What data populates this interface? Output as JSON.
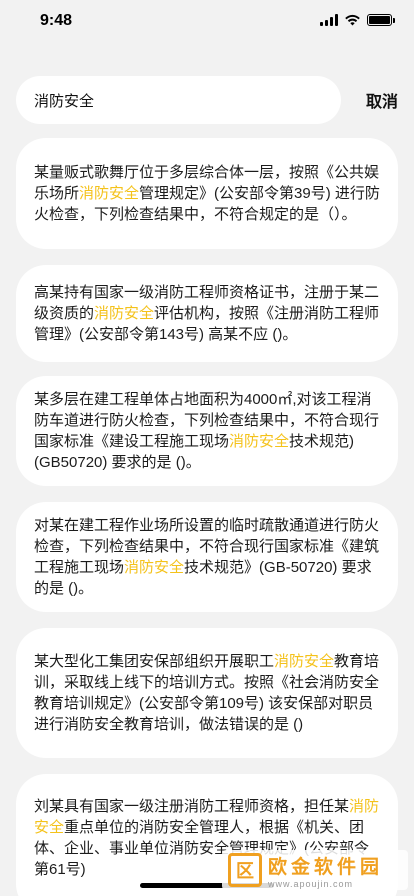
{
  "status_bar": {
    "time": "9:48"
  },
  "search": {
    "value": "消防安全",
    "cancel_label": "取消"
  },
  "highlight_color": "#f4c21b",
  "results": [
    {
      "segments": [
        "某量贩式歌舞厅位于多层综合体一层，按照《公共娱乐场所",
        "消防安全",
        "管理规定》(公安部令第39号) 进行防火检查，下列检查结果中，不符合规定的是（）。"
      ]
    },
    {
      "segments": [
        "高某持有国家一级消防工程师资格证书，注册于某二级资质的",
        "消防安全",
        "评估机构，按照《注册消防工程师管理》(公安部令第143号) 高某不应 ()。"
      ]
    },
    {
      "segments": [
        "某多层在建工程单体占地面积为4000㎡,对该工程消防车道进行防火检查，下列检查结果中，不符合现行国家标准《建设工程施工现场",
        "消防安全",
        "技术规范)(GB50720) 要求的是 ()。"
      ]
    },
    {
      "segments": [
        "对某在建工程作业场所设置的临时疏散通道进行防火检查，下列检查结果中，不符合现行国家标准《建筑工程施工现场",
        "消防安全",
        "技术规范》(GB-50720) 要求的是 ()。"
      ]
    },
    {
      "segments": [
        "某大型化工集团安保部组织开展职工",
        "消防安全",
        "教育培训，采取线上线下的培训方式。按照《社会消防安全教育培训规定》(公安部令第109号) 该安保部对职员进行消防安全教育培训，做法错误的是 ()"
      ]
    },
    {
      "segments": [
        "刘某具有国家一级注册消防工程师资格，担任某",
        "消防安全",
        "重点单位的消防安全管理人，根据《机关、团体、企业、事业单位消防安全管理规定》(公安部令第61号)"
      ]
    }
  ],
  "watermark": {
    "logo_char": "区",
    "title": "欧金软件园",
    "url": "www.apoujin.com"
  }
}
